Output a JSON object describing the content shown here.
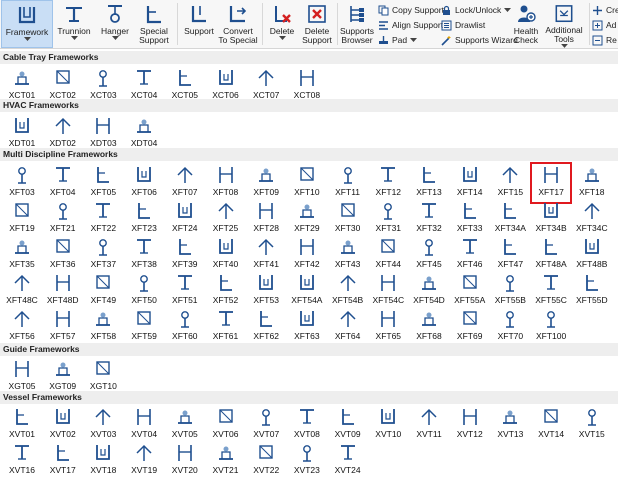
{
  "ribbon": {
    "framework": "Framework",
    "trunnion": "Trunnion",
    "hanger": "Hanger",
    "special_support_1": "Special",
    "special_support_2": "Support",
    "support": "Support",
    "convert_1": "Convert",
    "convert_2": "To Special",
    "delete": "Delete",
    "delete_support_1": "Delete",
    "delete_support_2": "Support",
    "supports_browser_1": "Supports",
    "supports_browser_2": "Browser",
    "copy_support": "Copy Support",
    "align_support": "Align Support",
    "pad": "Pad",
    "lock_unlock": "Lock/Unlock",
    "drawlist": "Drawlist",
    "supports_wizard": "Supports Wizard",
    "health_check_1": "Health",
    "health_check_2": "Check",
    "additional_tools_1": "Additional",
    "additional_tools_2": "Tools",
    "cut_1": "Cre",
    "cut_2": "Ad",
    "cut_3": "Re"
  },
  "sections": [
    {
      "title": "Cable Tray Frameworks",
      "items": [
        "XCT01",
        "XCT02",
        "XCT03",
        "XCT04",
        "XCT05",
        "XCT06",
        "XCT07",
        "XCT08"
      ]
    },
    {
      "title": "HVAC Frameworks",
      "items": [
        "XDT01",
        "XDT02",
        "XDT03",
        "XDT04"
      ]
    },
    {
      "title": "Multi Discipline Frameworks",
      "items": [
        "XFT03",
        "XFT04",
        "XFT05",
        "XFT06",
        "XFT07",
        "XFT08",
        "XFT09",
        "XFT10",
        "XFT11",
        "XFT12",
        "XFT13",
        "XFT14",
        "XFT15",
        "XFT17",
        "XFT18",
        "XFT19",
        "XFT21",
        "XFT22",
        "XFT23",
        "XFT24",
        "XFT25",
        "XFT28",
        "XFT29",
        "XFT30",
        "XFT31",
        "XFT32",
        "XFT33",
        "XFT34A",
        "XFT34B",
        "XFT34C",
        "XFT35",
        "XFT36",
        "XFT37",
        "XFT38",
        "XFT39",
        "XFT40",
        "XFT41",
        "XFT42",
        "XFT43",
        "XFT44",
        "XFT45",
        "XFT46",
        "XFT47",
        "XFT48A",
        "XFT48B",
        "XFT48C",
        "XFT48D",
        "XFT49",
        "XFT50",
        "XFT51",
        "XFT52",
        "XFT53",
        "XFT54A",
        "XFT54B",
        "XFT54C",
        "XFT54D",
        "XFT55A",
        "XFT55B",
        "XFT55C",
        "XFT55D",
        "XFT56",
        "XFT57",
        "XFT58",
        "XFT59",
        "XFT60",
        "XFT61",
        "XFT62",
        "XFT63",
        "XFT64",
        "XFT65",
        "XFT68",
        "XFT69",
        "XFT70",
        "XFT100"
      ]
    },
    {
      "title": "Guide Frameworks",
      "items": [
        "XGT05",
        "XGT09",
        "XGT10"
      ]
    },
    {
      "title": "Vessel Frameworks",
      "items": [
        "XVT01",
        "XVT02",
        "XVT03",
        "XVT04",
        "XVT05",
        "XVT06",
        "XVT07",
        "XVT08",
        "XVT09",
        "XVT10",
        "XVT11",
        "XVT12",
        "XVT13",
        "XVT14",
        "XVT15",
        "XVT16",
        "XVT17",
        "XVT18",
        "XVT19",
        "XVT20",
        "XVT21",
        "XVT22",
        "XVT23",
        "XVT24"
      ]
    }
  ],
  "selected_item": "XFT17",
  "colors": {
    "accent": "#1f4f8f",
    "highlight": "#e0191f",
    "delete_red": "#d42020",
    "header_bg": "#eeeeee"
  }
}
